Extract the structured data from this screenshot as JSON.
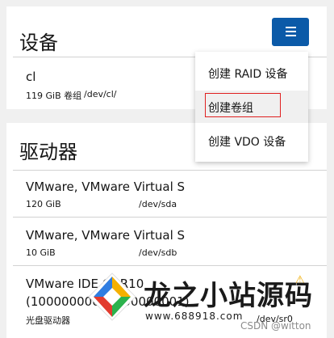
{
  "devices_card": {
    "title": "设备",
    "items": [
      {
        "name": "cl",
        "size": "119 GiB 卷组",
        "path": "/dev/cl/"
      }
    ]
  },
  "menu_button": {
    "icon": "hamburger-icon",
    "color": "#0b5aa8"
  },
  "dropdown": {
    "items": [
      {
        "label": "创建 RAID 设备"
      },
      {
        "label": "创建卷组"
      },
      {
        "label": "创建 VDO 设备"
      }
    ],
    "focused_item": "创建卷组"
  },
  "drives_card": {
    "title": "驱动器",
    "items": [
      {
        "name": "VMware, VMware Virtual S",
        "size": "120 GiB",
        "path": "/dev/sda"
      },
      {
        "name": "VMware, VMware Virtual S",
        "size": "10 GiB",
        "path": "/dev/sdb"
      },
      {
        "name": "VMware IDE CDR10",
        "name_line2": "(10000000000000000001)",
        "type": "光盘驱动器",
        "path": "/dev/sr0"
      }
    ]
  },
  "watermark": {
    "brand": "龙之小站源码",
    "url": "www.688918.com"
  },
  "credit": "CSDN @witton"
}
